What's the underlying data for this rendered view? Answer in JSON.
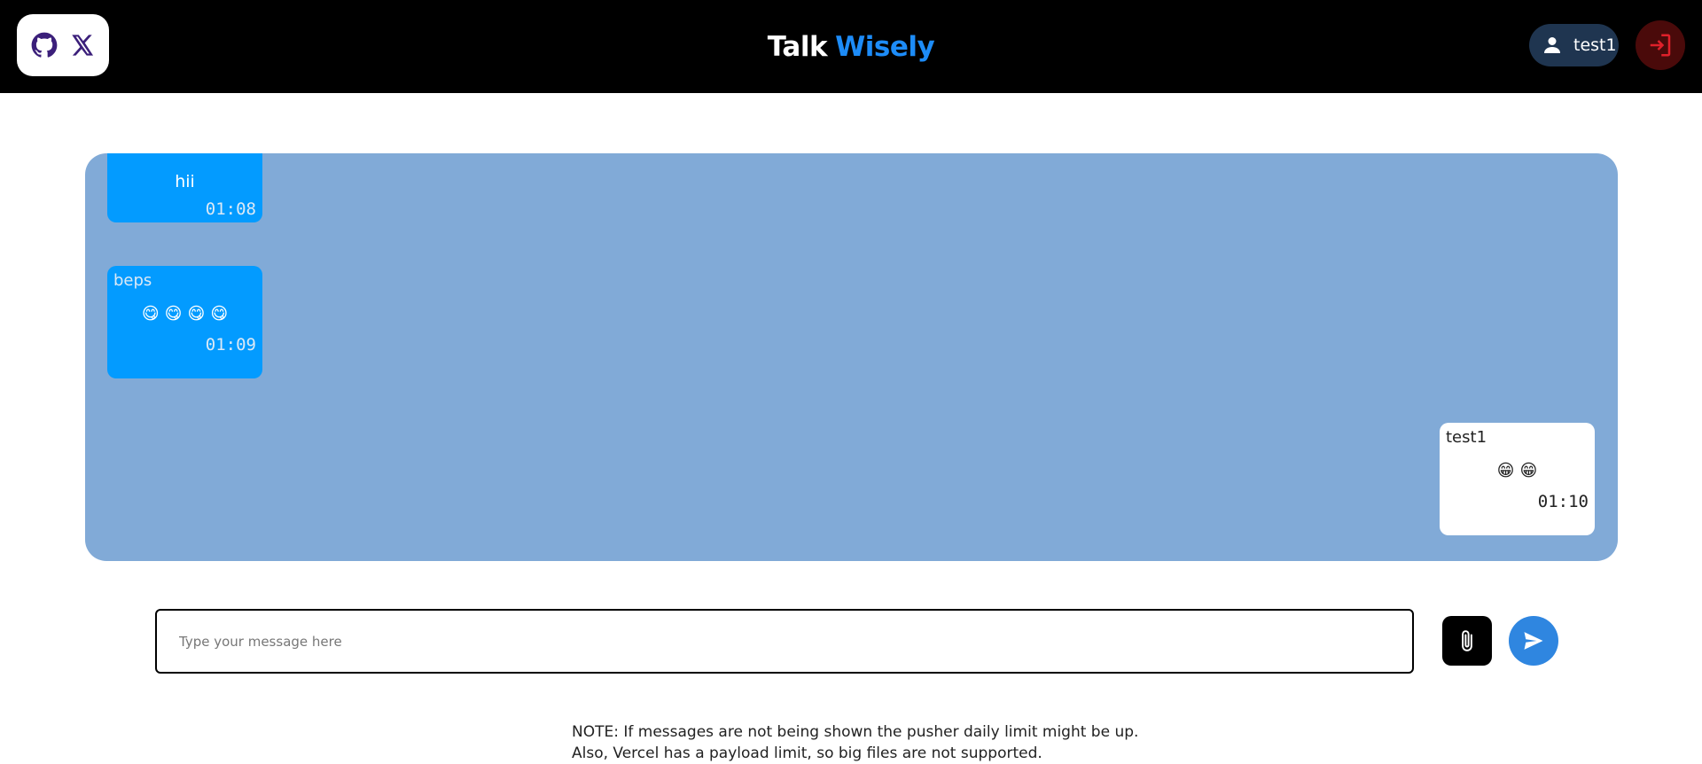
{
  "header": {
    "brand_first": "Talk",
    "brand_second": "Wisely",
    "username": "test1",
    "social": [
      "github-icon",
      "x-icon"
    ],
    "colors": {
      "brand_accent": "#1d8cf8",
      "header_bg": "#000000",
      "logout_icon": "#e0202a"
    }
  },
  "chat": {
    "background": "#81aad7",
    "messages": [
      {
        "direction": "incoming",
        "sender": "",
        "content": "hii",
        "time": "01:08"
      },
      {
        "direction": "incoming",
        "sender": "beps",
        "content": "😋 😋 😋 😋",
        "time": "01:09"
      },
      {
        "direction": "outgoing",
        "sender": "test1",
        "content": "😁 😁",
        "time": "01:10"
      }
    ]
  },
  "composer": {
    "placeholder": "Type your message here",
    "value": ""
  },
  "note": {
    "line1": "NOTE: If messages are not being shown the pusher daily limit might be up.",
    "line2": "Also, Vercel has a payload limit, so big files are not supported."
  }
}
